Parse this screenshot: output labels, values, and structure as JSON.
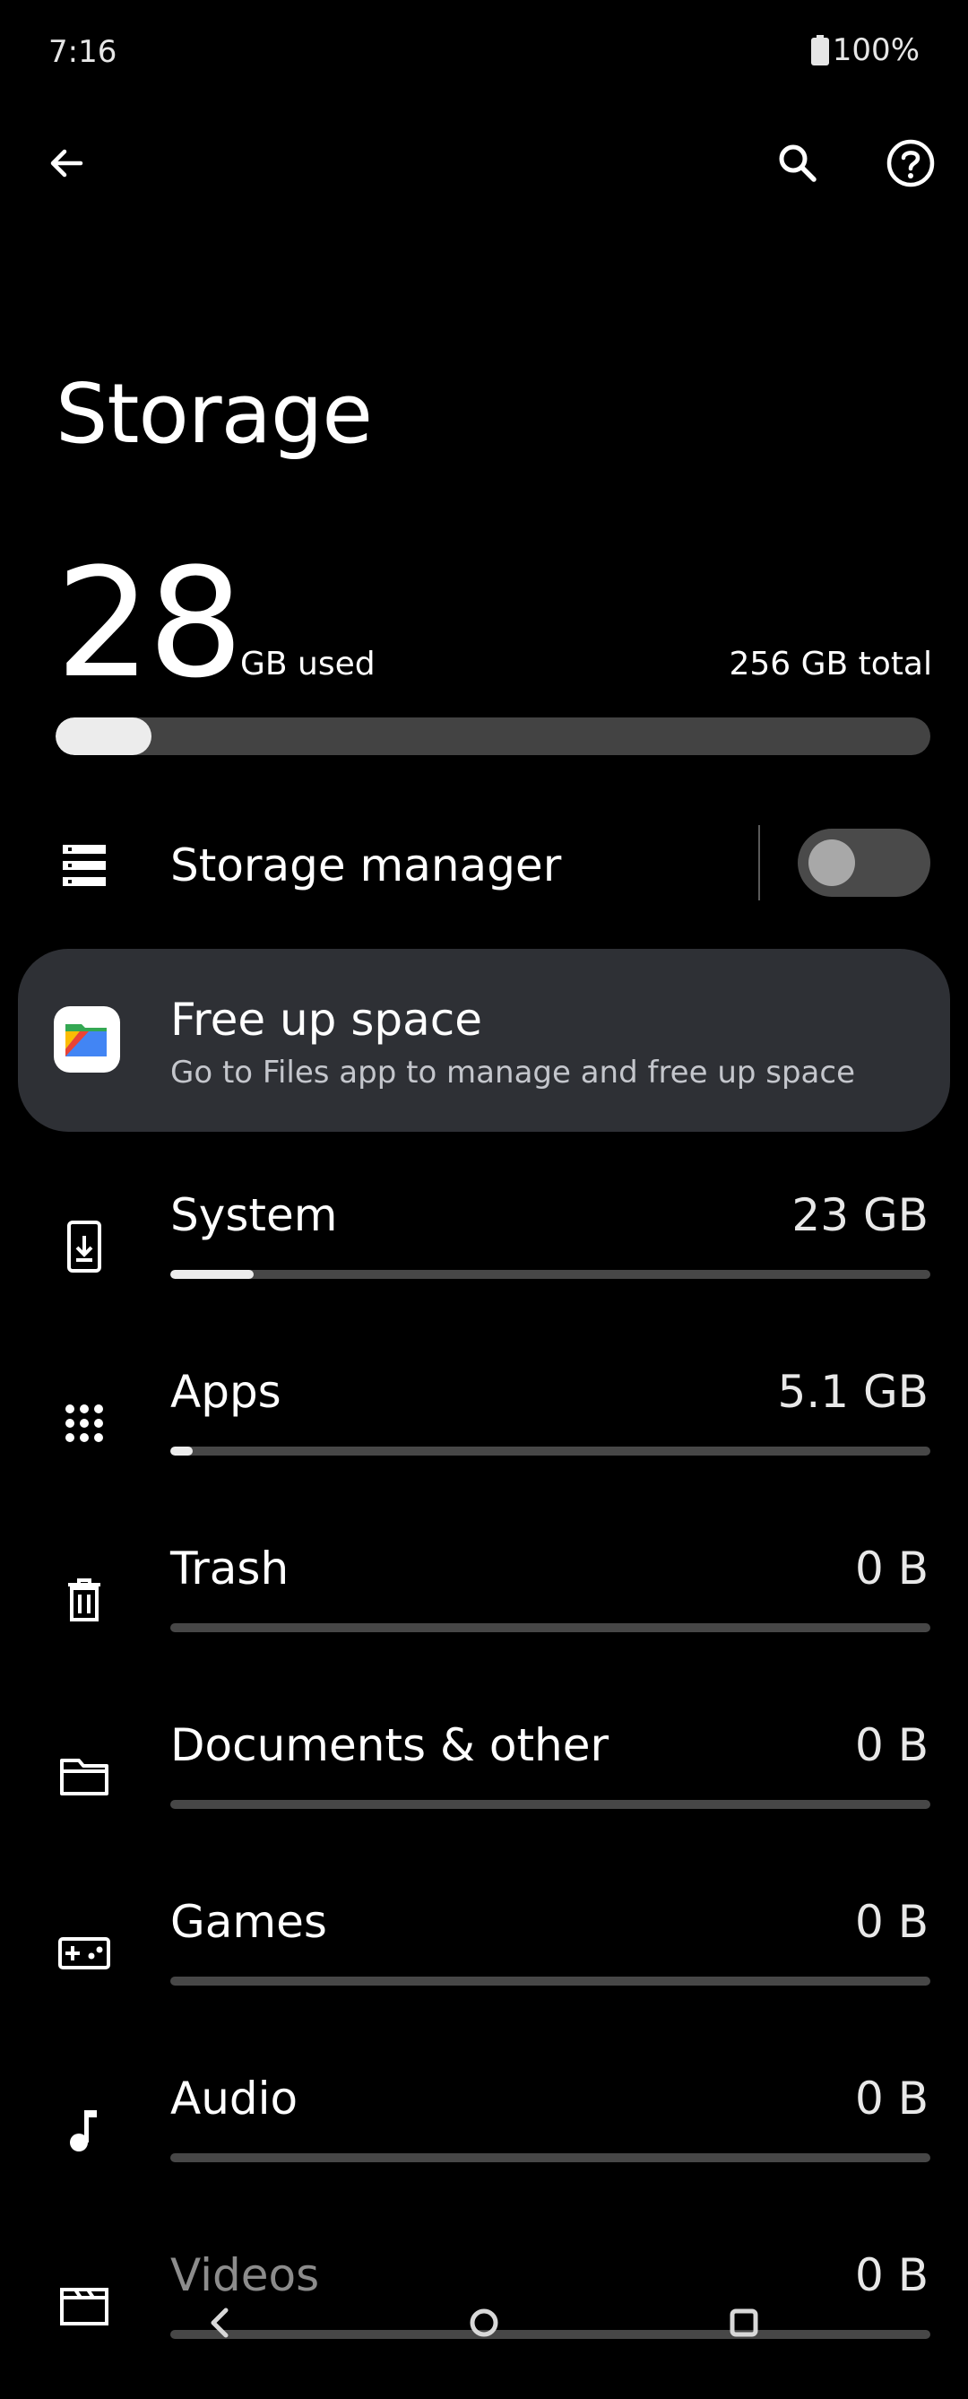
{
  "status": {
    "time": "7:16",
    "battery": "100%"
  },
  "header": {
    "title": "Storage"
  },
  "usage": {
    "used_value": "28",
    "used_unit": "GB used",
    "total": "256 GB total",
    "used_fraction": 0.11
  },
  "storage_manager": {
    "label": "Storage manager",
    "enabled": false
  },
  "free_up": {
    "title": "Free up space",
    "subtitle": "Go to Files app to manage and free up space"
  },
  "categories": [
    {
      "label": "System",
      "size": "23 GB",
      "fraction": 0.11,
      "icon": "phone-download-icon"
    },
    {
      "label": "Apps",
      "size": "5.1 GB",
      "fraction": 0.03,
      "icon": "apps-grid-icon"
    },
    {
      "label": "Trash",
      "size": "0 B",
      "fraction": 0,
      "icon": "trash-icon"
    },
    {
      "label": "Documents & other",
      "size": "0 B",
      "fraction": 0,
      "icon": "folder-icon"
    },
    {
      "label": "Games",
      "size": "0 B",
      "fraction": 0,
      "icon": "gamepad-icon"
    },
    {
      "label": "Audio",
      "size": "0 B",
      "fraction": 0,
      "icon": "music-note-icon"
    },
    {
      "label": "Videos",
      "size": "0 B",
      "fraction": 0,
      "icon": "clapperboard-icon"
    }
  ],
  "colors": {
    "background": "#000000",
    "card": "#2e3035",
    "bar_track": "#474747",
    "bar_fill": "#ececec"
  }
}
